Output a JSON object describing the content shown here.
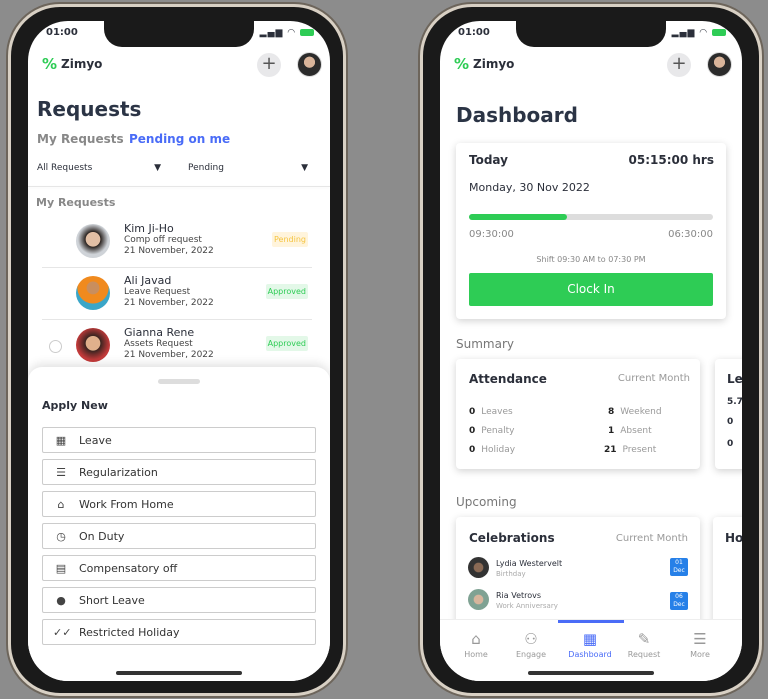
{
  "left": {
    "status_time": "01:00",
    "brand": "Zimyo",
    "title": "Requests",
    "tabs": [
      {
        "label": "My Requests",
        "active": false
      },
      {
        "label": "Pending on me",
        "active": true
      }
    ],
    "filters": [
      {
        "value": "All Requests"
      },
      {
        "value": "Pending"
      }
    ],
    "section": "My Requests",
    "requests": [
      {
        "name": "Kim Ji-Ho",
        "type": "Comp off request",
        "date": "21 November, 2022",
        "status": "Pending"
      },
      {
        "name": "Ali Javad",
        "type": "Leave Request",
        "date": "21 November, 2022",
        "status": "Approved"
      },
      {
        "name": "Gianna Rene",
        "type": "Assets Request",
        "date": "21 November, 2022",
        "status": "Approved"
      }
    ],
    "sheet": {
      "title": "Apply New",
      "options": [
        {
          "label": "Leave",
          "icon": "calendar-icon"
        },
        {
          "label": "Regularization",
          "icon": "list-icon"
        },
        {
          "label": "Work From Home",
          "icon": "home-icon"
        },
        {
          "label": "On Duty",
          "icon": "clock-icon"
        },
        {
          "label": "Compensatory off",
          "icon": "calendar-grid-icon"
        },
        {
          "label": "Short Leave",
          "icon": "user-clock-icon"
        },
        {
          "label": "Restricted Holiday",
          "icon": "double-check-icon"
        }
      ]
    }
  },
  "right": {
    "status_time": "01:00",
    "brand": "Zimyo",
    "title": "Dashboard",
    "today": {
      "label": "Today",
      "hours": "05:15:00 hrs",
      "date": "Monday, 30 Nov 2022",
      "progress": 0.4,
      "start": "09:30:00",
      "end": "06:30:00",
      "shift": "Shift 09:30 AM to 07:30 PM",
      "button": "Clock In"
    },
    "summary_label": "Summary",
    "attendance": {
      "title": "Attendance",
      "period": "Current Month",
      "left": [
        {
          "value": "0",
          "label": "Leaves"
        },
        {
          "value": "0",
          "label": "Penalty"
        },
        {
          "value": "0",
          "label": "Holiday"
        }
      ],
      "right": [
        {
          "value": "8",
          "label": "Weekend"
        },
        {
          "value": "1",
          "label": "Absent"
        },
        {
          "value": "21",
          "label": "Present"
        }
      ]
    },
    "second_card": {
      "title": "Le",
      "values": [
        "5.7",
        "0",
        "0"
      ]
    },
    "upcoming_label": "Upcoming",
    "celebrations": {
      "title": "Celebrations",
      "period": "Current Month",
      "items": [
        {
          "name": "Lydia Westervelt",
          "event": "Birthday",
          "day": "01",
          "month": "Dec"
        },
        {
          "name": "Ria Vetrovs",
          "event": "Work Anniversary",
          "day": "06",
          "month": "Dec"
        }
      ]
    },
    "holiday_card": {
      "title": "Ho"
    },
    "nav": [
      {
        "label": "Home",
        "icon": "home-icon",
        "active": false
      },
      {
        "label": "Engage",
        "icon": "users-icon",
        "active": false
      },
      {
        "label": "Dashboard",
        "icon": "grid-icon",
        "active": true
      },
      {
        "label": "Request",
        "icon": "edit-icon",
        "active": false
      },
      {
        "label": "More",
        "icon": "menu-icon",
        "active": false
      }
    ],
    "colors": {
      "accent": "#4a6cf7",
      "green": "#2ecc55",
      "pending": "#f5c542",
      "approved": "#2ecc55"
    }
  }
}
